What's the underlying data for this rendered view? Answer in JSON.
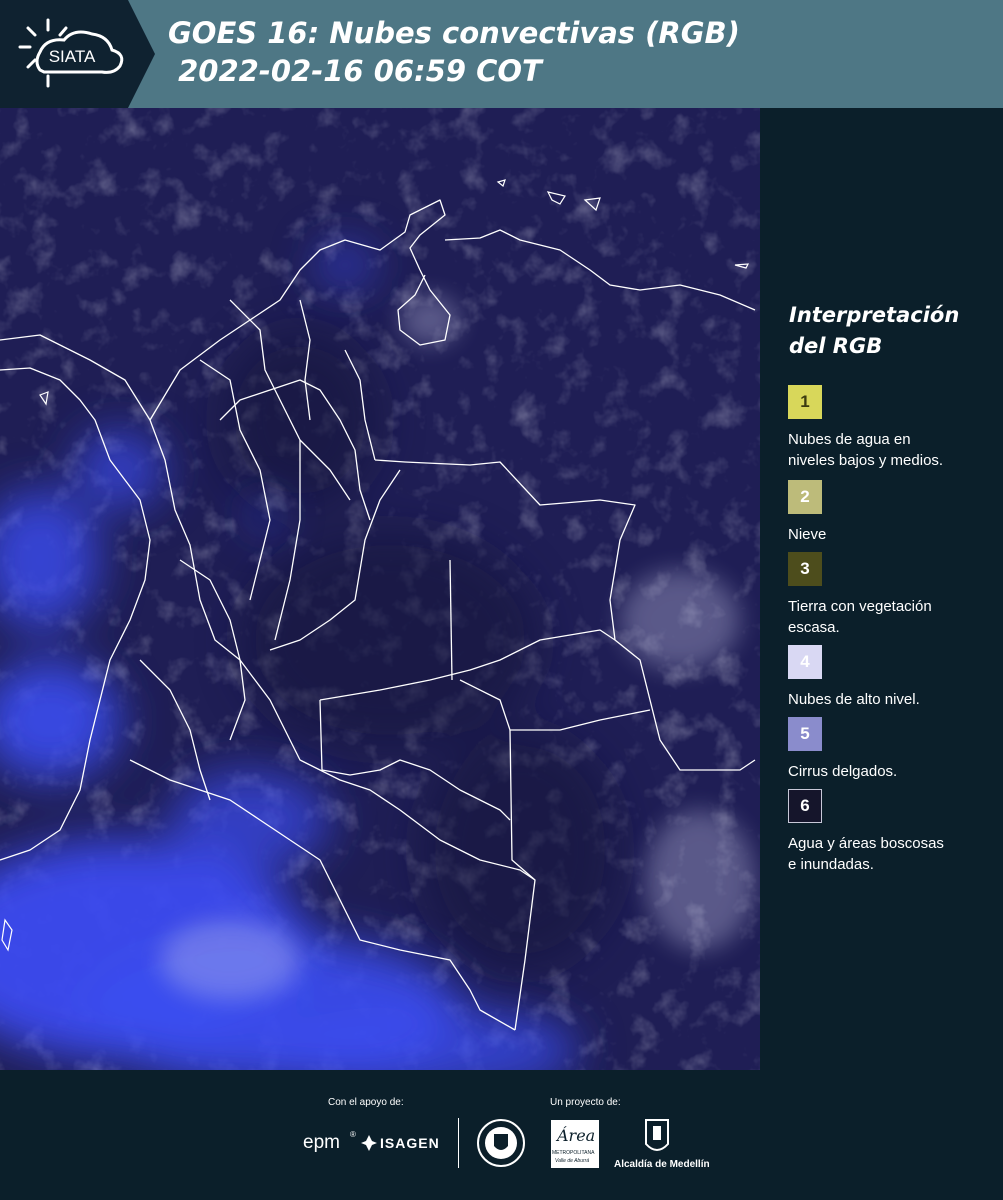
{
  "header": {
    "logo_text": "SIATA",
    "title_line1": "GOES 16: Nubes convectivas (RGB)",
    "title_line2": " 2022-02-16 06:59 COT"
  },
  "legend": {
    "title_line1": "Interpretación",
    "title_line2": "del RGB",
    "items": [
      {
        "number": "1",
        "label_line1": "Nubes de agua en",
        "label_line2": "niveles bajos y medios.",
        "color": "#d8d75a",
        "text_color": "#3b3b10"
      },
      {
        "number": "2",
        "label_line1": "Nieve",
        "label_line2": "",
        "color": "#bdbb7a",
        "text_color": "#ffffff"
      },
      {
        "number": "3",
        "label_line1": "Tierra con vegetación",
        "label_line2": "escasa.",
        "color": "#4d4d1c",
        "text_color": "#ffffff"
      },
      {
        "number": "4",
        "label_line1": "Nubes de alto nivel.",
        "label_line2": "",
        "color": "#d9d8f3",
        "text_color": "#ffffff"
      },
      {
        "number": "5",
        "label_line1": "Cirrus delgados.",
        "label_line2": "",
        "color": "#8a8ccc",
        "text_color": "#ffffff"
      },
      {
        "number": "6",
        "label_line1": "Agua y áreas boscosas",
        "label_line2": "e inundadas.",
        "color": "#15152b",
        "text_color": "#ffffff"
      }
    ]
  },
  "footer": {
    "support_label": "Con el apoyo de:",
    "project_label": "Un proyecto de:",
    "epm": "epm",
    "isagen": "ISAGEN",
    "area_name": "Área",
    "area_sub1": "METROPOLITANA",
    "area_sub2": "Valle de Aburrá",
    "alcaldia": "Alcaldía de Medellín"
  },
  "colors": {
    "header_bg": "#4e7785",
    "logo_bg": "#0f2230",
    "page_bg": "#0b1f2a",
    "map_bg": "#1e1d52",
    "cloud_blue": "#3a49e8"
  }
}
